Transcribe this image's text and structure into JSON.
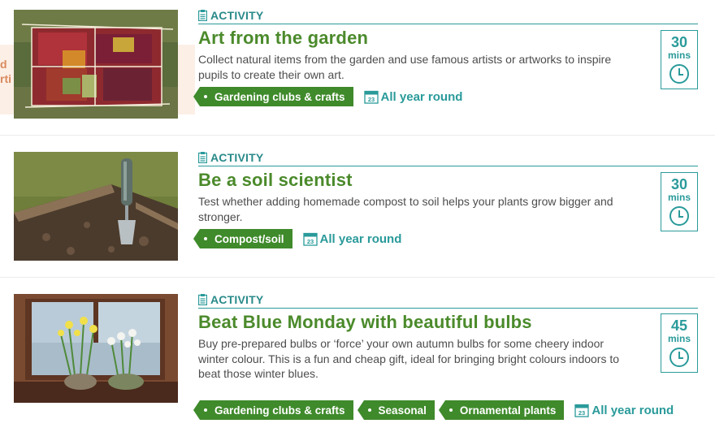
{
  "activities": [
    {
      "kind_label": "ACTIVITY",
      "title": "Art from the garden",
      "description": "Collect natural items from the garden and use famous artists or artworks to inspire pupils to create their own art.",
      "tags": [
        "Gardening clubs & crafts"
      ],
      "season": "All year round",
      "duration_value": "30",
      "duration_unit": "mins",
      "image_subject": "leaf-art-grid-photo"
    },
    {
      "kind_label": "ACTIVITY",
      "title": "Be a soil scientist",
      "description": "Test whether adding homemade compost to soil helps your plants grow bigger and stronger.",
      "tags": [
        "Compost/soil"
      ],
      "season": "All year round",
      "duration_value": "30",
      "duration_unit": "mins",
      "image_subject": "trowel-in-soil-photo"
    },
    {
      "kind_label": "ACTIVITY",
      "title": "Beat Blue Monday with beautiful bulbs",
      "description": "Buy pre-prepared bulbs or ‘force’ your own autumn bulbs for some cheery indoor winter colour. This is a fun and cheap gift, ideal for bringing bright colours indoors to beat those winter blues.",
      "tags": [
        "Gardening clubs & crafts",
        "Seasonal",
        "Ornamental plants"
      ],
      "season": "All year round",
      "duration_value": "45",
      "duration_unit": "mins",
      "image_subject": "daffodil-bulbs-windowsill-photo"
    }
  ],
  "peek_text": [
    "d",
    "rti"
  ],
  "colors": {
    "title_green": "#4b8a2b",
    "tag_green": "#3f8a2b",
    "teal": "#2a9a9a",
    "text_grey": "#4d4d4d"
  },
  "icons": {
    "kind": "clipboard-icon",
    "season": "calendar-icon",
    "duration": "clock-icon",
    "calendar_day": "23"
  }
}
